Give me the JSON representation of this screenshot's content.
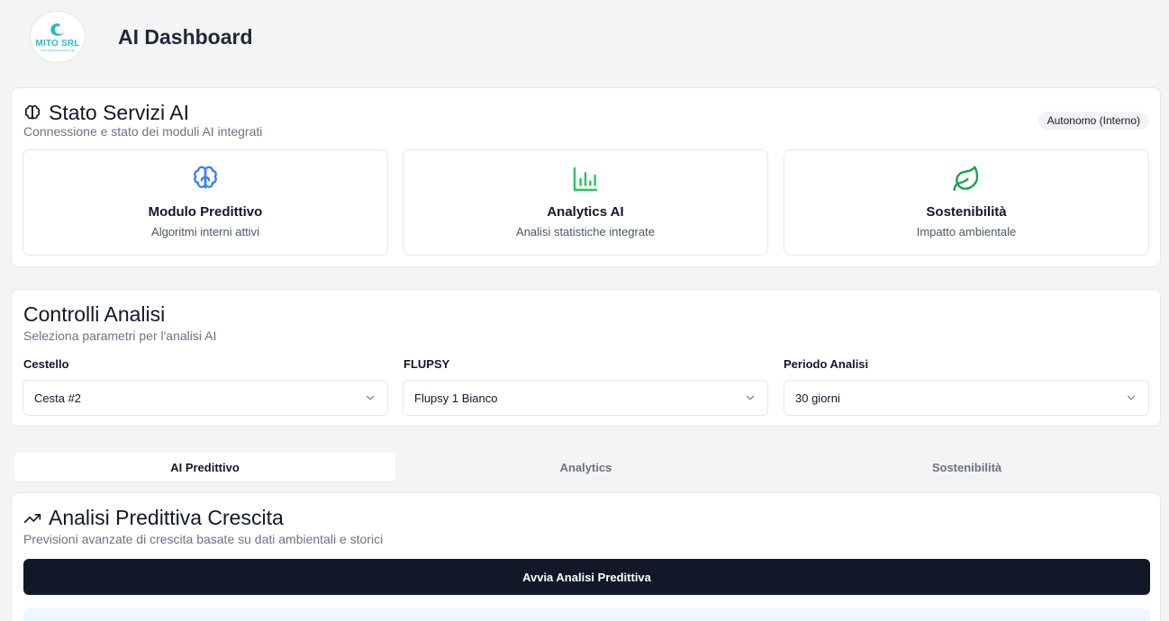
{
  "header": {
    "logo_text": "MITO SRL",
    "logo_sub": "SOLUZIONI EDOLOGICHE",
    "title": "AI Dashboard"
  },
  "services": {
    "title": "Stato Servizi AI",
    "subtitle": "Connessione e stato dei moduli AI integrati",
    "badge": "Autonomo (Interno)",
    "items": [
      {
        "name": "Modulo Predittivo",
        "desc": "Algoritmi interni attivi",
        "icon": "brain-icon",
        "color": "#3b82f6"
      },
      {
        "name": "Analytics AI",
        "desc": "Analisi statistiche integrate",
        "icon": "bar-chart-icon",
        "color": "#22c55e"
      },
      {
        "name": "Sostenibilità",
        "desc": "Impatto ambientale",
        "icon": "leaf-icon",
        "color": "#16a34a"
      }
    ]
  },
  "controls": {
    "title": "Controlli Analisi",
    "subtitle": "Seleziona parametri per l'analisi AI",
    "fields": [
      {
        "label": "Cestello",
        "value": "Cesta #2"
      },
      {
        "label": "FLUPSY",
        "value": "Flupsy 1 Bianco"
      },
      {
        "label": "Periodo Analisi",
        "value": "30 giorni"
      }
    ]
  },
  "tabs": [
    {
      "label": "AI Predittivo",
      "active": true
    },
    {
      "label": "Analytics",
      "active": false
    },
    {
      "label": "Sostenibilità",
      "active": false
    }
  ],
  "predictive": {
    "title": "Analisi Predittiva Crescita",
    "subtitle": "Previsioni avanzate di crescita basate su dati ambientali e storici",
    "button": "Avvia Analisi Predittiva"
  }
}
